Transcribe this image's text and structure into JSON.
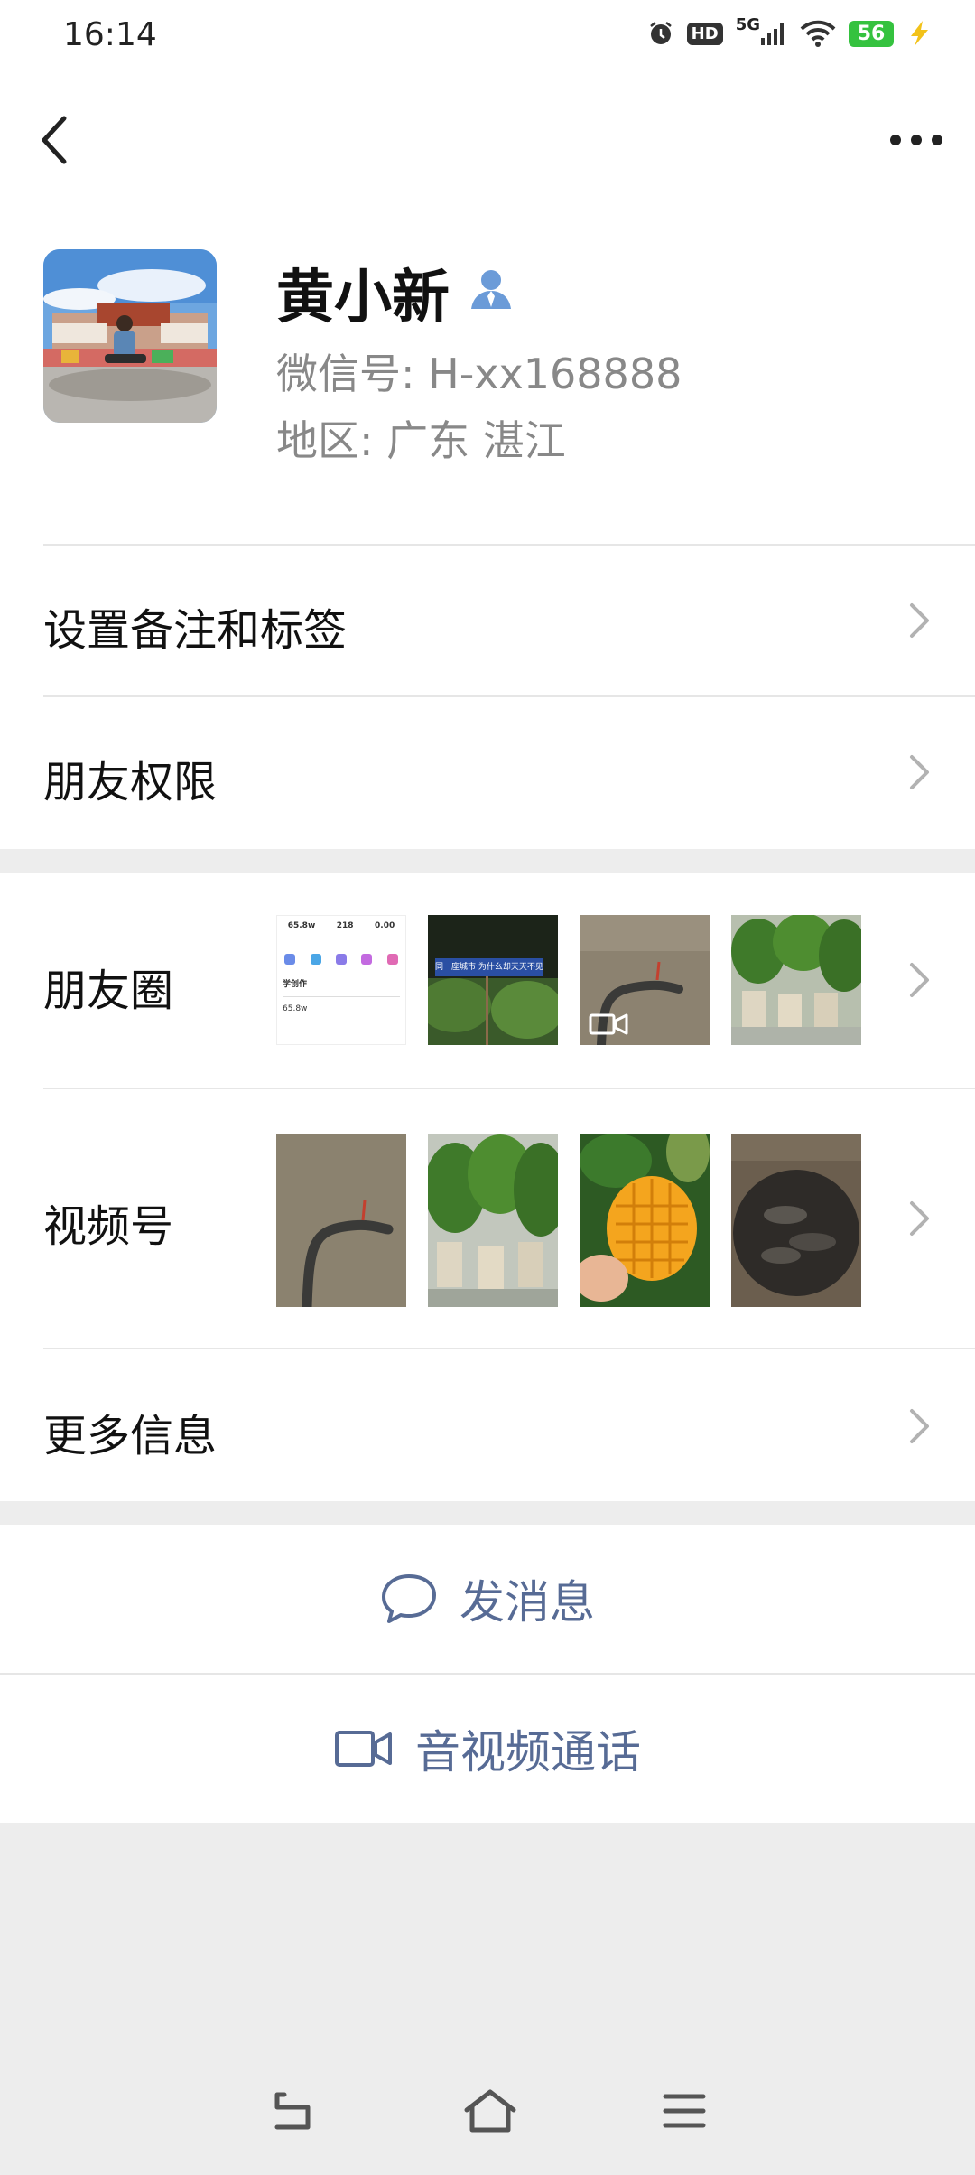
{
  "status_bar": {
    "time": "16:14",
    "icons": [
      "alarm-icon",
      "hd-icon",
      "5g-signal-icon",
      "wifi-icon",
      "battery-icon",
      "charging-icon"
    ],
    "hd": "HD",
    "network": "5G",
    "battery": "56"
  },
  "profile": {
    "name": "黄小新",
    "wechat_id": "微信号: H-xx168888",
    "region": "地区: 广东 湛江"
  },
  "menu": {
    "remark_tags": "设置备注和标签",
    "friend_permissions": "朋友权限",
    "moments": "朋友圈",
    "channels": "视频号",
    "more_info": "更多信息"
  },
  "moments_mini": {
    "stats": [
      "65.8w",
      "218",
      "0.00"
    ],
    "heading": "学创作",
    "value": "65.8w"
  },
  "moments_sign": "同一座城市 为什么却天天不见",
  "actions": {
    "send_message": "发消息",
    "voice_video_call": "音视频通话"
  },
  "colors": {
    "link": "#576b95",
    "background": "#ededed",
    "card": "#ffffff",
    "divider": "#e6e6e6"
  }
}
